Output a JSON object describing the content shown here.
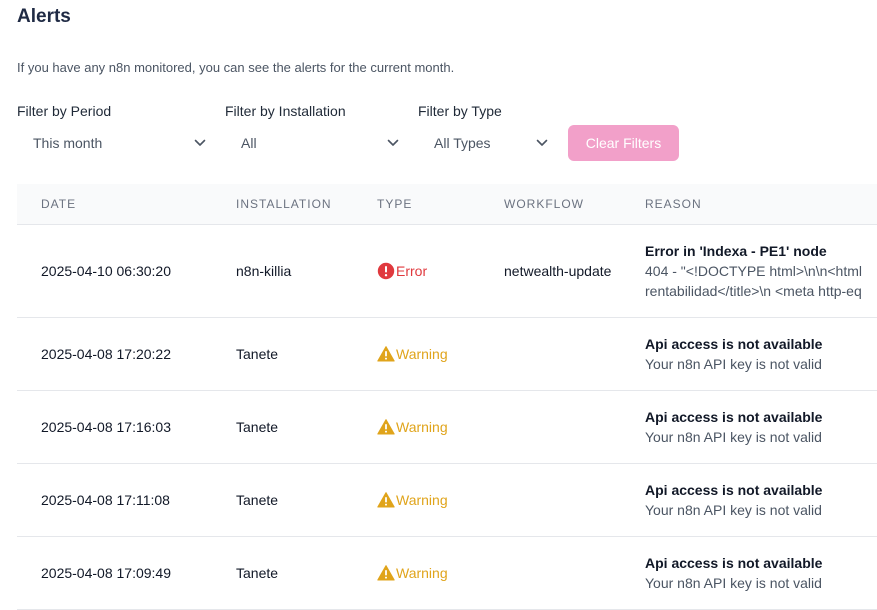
{
  "header": {
    "title": "Alerts",
    "description": "If you have any n8n monitored, you can see the alerts for the current month."
  },
  "filters": {
    "period": {
      "label": "Filter by Period",
      "value": "This month"
    },
    "installation": {
      "label": "Filter by Installation",
      "value": "All"
    },
    "type": {
      "label": "Filter by Type",
      "value": "All Types"
    },
    "clear_label": "Clear Filters"
  },
  "table": {
    "columns": [
      "DATE",
      "INSTALLATION",
      "TYPE",
      "WORKFLOW",
      "REASON"
    ],
    "rows": [
      {
        "date": "2025-04-10 06:30:20",
        "installation": "n8n-killia",
        "type": "Error",
        "type_icon": "error-circle-icon",
        "workflow": "netwealth-update",
        "reason_title": "Error in 'Indexa - PE1' node",
        "reason_detail": "404 - \"<!DOCTYPE html>\\n\\n<html",
        "reason_detail_2": "rentabilidad</title>\\n <meta http-eq"
      },
      {
        "date": "2025-04-08 17:20:22",
        "installation": "Tanete",
        "type": "Warning",
        "type_icon": "warning-triangle-icon",
        "workflow": "",
        "reason_title": "Api access is not available",
        "reason_detail": "Your n8n API key is not valid"
      },
      {
        "date": "2025-04-08 17:16:03",
        "installation": "Tanete",
        "type": "Warning",
        "type_icon": "warning-triangle-icon",
        "workflow": "",
        "reason_title": "Api access is not available",
        "reason_detail": "Your n8n API key is not valid"
      },
      {
        "date": "2025-04-08 17:11:08",
        "installation": "Tanete",
        "type": "Warning",
        "type_icon": "warning-triangle-icon",
        "workflow": "",
        "reason_title": "Api access is not available",
        "reason_detail": "Your n8n API key is not valid"
      },
      {
        "date": "2025-04-08 17:09:49",
        "installation": "Tanete",
        "type": "Warning",
        "type_icon": "warning-triangle-icon",
        "workflow": "",
        "reason_title": "Api access is not available",
        "reason_detail": "Your n8n API key is not valid"
      }
    ]
  },
  "colors": {
    "accent_button": "#f2a0c9",
    "error": "#e0393e",
    "warning": "#e0a41b",
    "title": "#1f2a44"
  }
}
